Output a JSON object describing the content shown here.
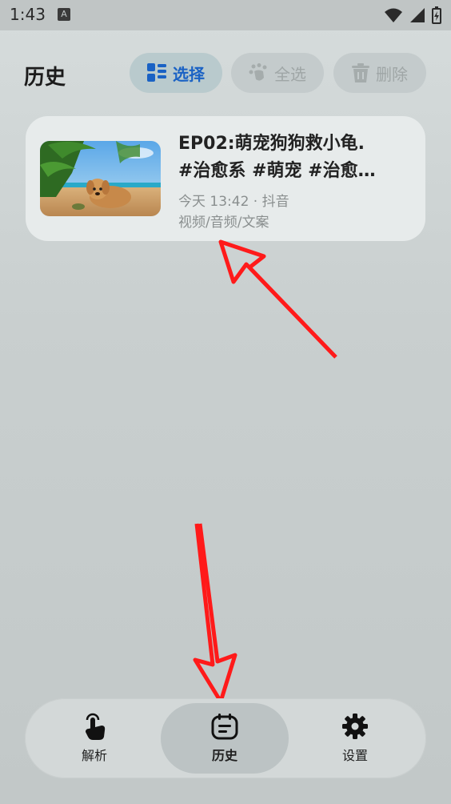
{
  "status": {
    "time": "1:43",
    "badge": "A"
  },
  "header": {
    "title": "历史"
  },
  "toolbar": {
    "select_label": "选择",
    "select_all_label": "全选",
    "delete_label": "删除"
  },
  "history": {
    "items": [
      {
        "title_line1": "EP02:萌宠狗狗救小龟.",
        "title_line2": "#治愈系 #萌宠 #治愈…",
        "time_source": "今天 13:42 · 抖音",
        "types": "视频/音频/文案"
      }
    ]
  },
  "nav": {
    "parse_label": "解析",
    "history_label": "历史",
    "settings_label": "设置"
  },
  "colors": {
    "accent": "#1a62c4",
    "arrow": "#ff1a1a"
  }
}
